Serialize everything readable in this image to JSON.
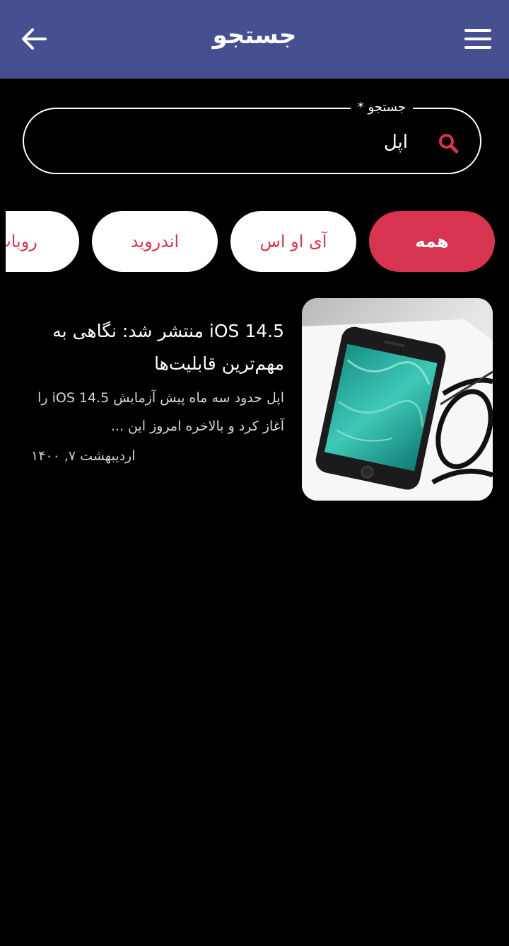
{
  "header": {
    "title": "جستجو",
    "back_icon": "arrow-left-icon",
    "menu_icon": "hamburger-menu-icon"
  },
  "search": {
    "label": "جستجو *",
    "value": "اپل",
    "icon": "search-icon",
    "icon_color": "#d6344f"
  },
  "categories": [
    {
      "label": "همه",
      "active": true
    },
    {
      "label": "آی او اس",
      "active": false
    },
    {
      "label": "اندروید",
      "active": false
    },
    {
      "label": "روبات",
      "active": false
    }
  ],
  "articles": [
    {
      "title": "iOS 14.5 منتشر شد: نگاهی به مهم‌ترین قابلیت‌ها",
      "summary": "اپل حدود سه ماه پیش آزمایش iOS 14.5 را آغاز کرد و بالاخره امروز این ...",
      "date": "اردیبهشت ۷, ۱۴۰۰",
      "thumbnail": "iphone-and-glasses-image"
    }
  ],
  "colors": {
    "header_bg": "#465090",
    "accent": "#d6344f",
    "background": "#000000"
  }
}
